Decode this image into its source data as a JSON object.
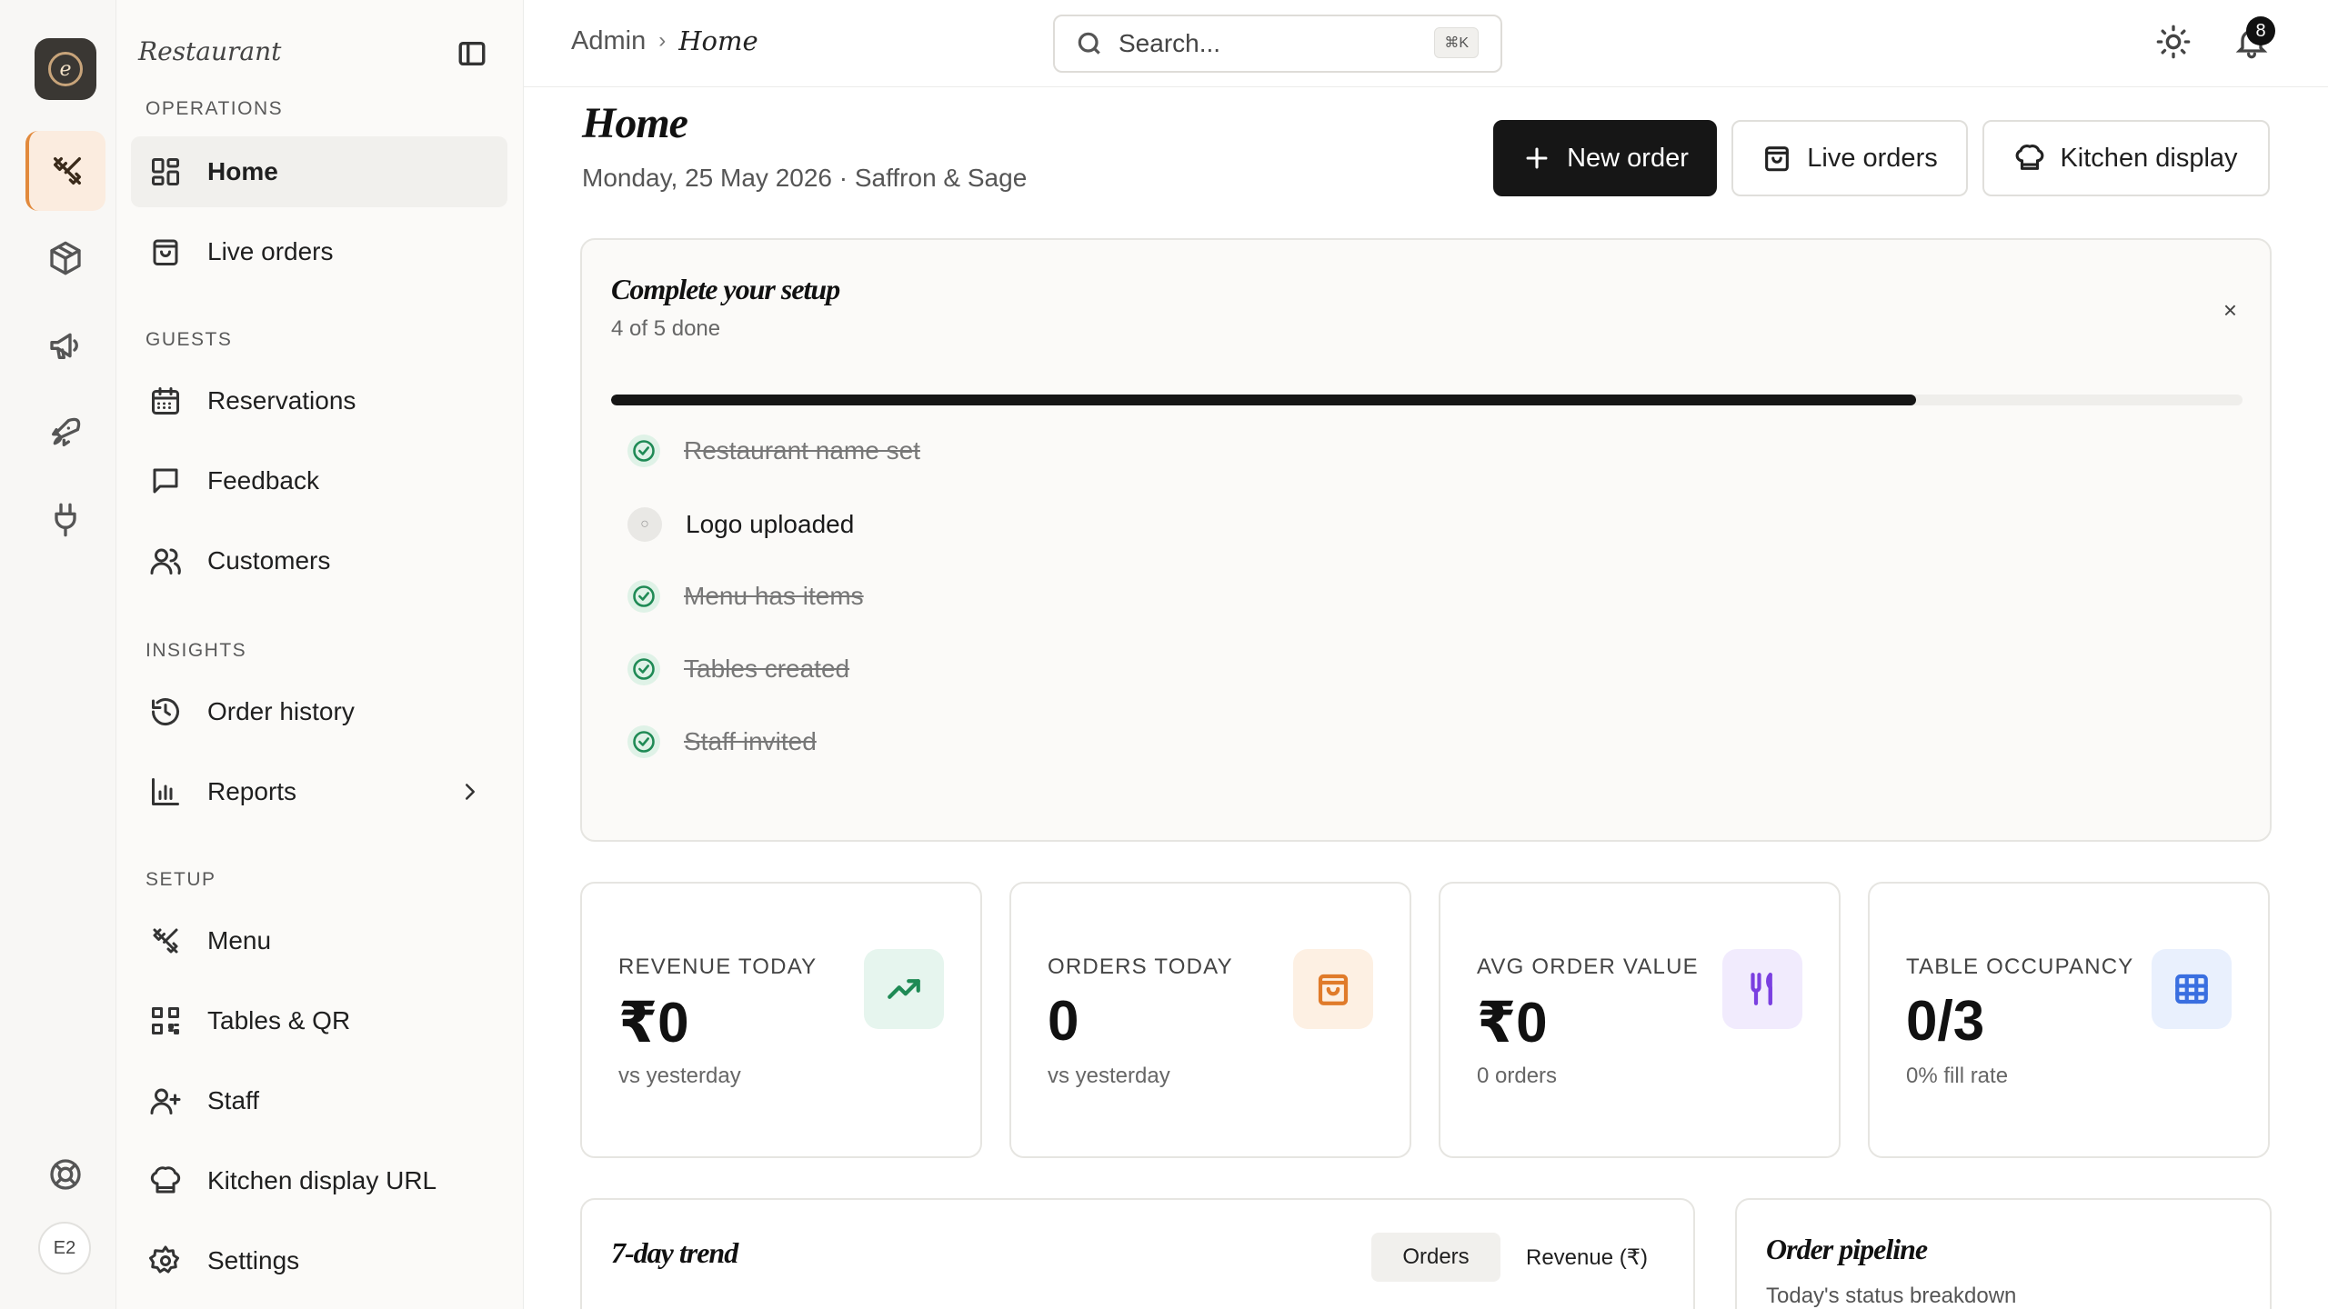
{
  "rail": {
    "avatar_initials": "E2"
  },
  "sidebar": {
    "brand": "Restaurant",
    "sections": {
      "operations": "OPERATIONS",
      "guests": "GUESTS",
      "insights": "INSIGHTS",
      "setup": "SETUP"
    },
    "items": [
      {
        "label": "Home",
        "icon": "grid-icon"
      },
      {
        "label": "Live orders",
        "icon": "bag-icon"
      },
      {
        "label": "Reservations",
        "icon": "calendar-icon"
      },
      {
        "label": "Feedback",
        "icon": "message-icon"
      },
      {
        "label": "Customers",
        "icon": "users-icon"
      },
      {
        "label": "Order history",
        "icon": "history-icon"
      },
      {
        "label": "Reports",
        "icon": "bar-chart-icon"
      },
      {
        "label": "Menu",
        "icon": "utensils-icon"
      },
      {
        "label": "Tables & QR",
        "icon": "qr-icon"
      },
      {
        "label": "Staff",
        "icon": "user-plus-icon"
      },
      {
        "label": "Kitchen display URL",
        "icon": "chef-hat-icon"
      },
      {
        "label": "Settings",
        "icon": "gear-icon"
      }
    ]
  },
  "topbar": {
    "breadcrumb_root": "Admin",
    "breadcrumb_current": "Home",
    "search_placeholder": "Search...",
    "search_shortcut": "⌘K",
    "notification_count": "8"
  },
  "header": {
    "title": "Home",
    "subtitle": "Monday, 25 May 2026 · Saffron & Sage",
    "new_order": "New order",
    "live_orders": "Live orders",
    "kitchen_display": "Kitchen display"
  },
  "setup": {
    "title": "Complete your setup",
    "progress_text": "4 of 5 done",
    "progress_fraction": 0.8,
    "close": "×",
    "steps": [
      {
        "label": "Restaurant name set",
        "done": true
      },
      {
        "label": "Logo uploaded",
        "done": false
      },
      {
        "label": "Menu has items",
        "done": true
      },
      {
        "label": "Tables created",
        "done": true
      },
      {
        "label": "Staff invited",
        "done": true
      }
    ]
  },
  "stats": [
    {
      "label": "REVENUE TODAY",
      "value": "₹0",
      "note": "vs yesterday",
      "icon": "trending-up-icon",
      "bg": "#e6f5ee",
      "fg": "#1f8a55"
    },
    {
      "label": "ORDERS TODAY",
      "value": "0",
      "note": "vs yesterday",
      "icon": "shopping-bag-icon",
      "bg": "#fdf0e3",
      "fg": "#e07b2a"
    },
    {
      "label": "AVG ORDER VALUE",
      "value": "₹0",
      "note": "0 orders",
      "icon": "utensils-icon",
      "bg": "#f1ebfd",
      "fg": "#7a3fe0"
    },
    {
      "label": "TABLE OCCUPANCY",
      "value": "0/3",
      "note": "0% fill rate",
      "icon": "table-icon",
      "bg": "#e9f0fd",
      "fg": "#3a6fe0"
    }
  ],
  "trend": {
    "title": "7-day trend",
    "tab_orders": "Orders",
    "tab_revenue": "Revenue (₹)"
  },
  "pipeline": {
    "title": "Order pipeline",
    "subtitle": "Today's status breakdown"
  }
}
